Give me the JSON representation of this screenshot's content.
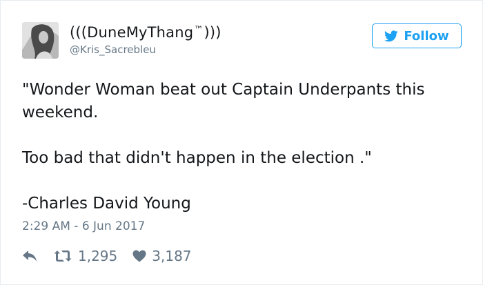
{
  "user": {
    "display_name": "(((DuneMyThang",
    "trademark": "™",
    "name_suffix": ")))",
    "handle": "@Kris_Sacrebleu",
    "avatar_icon": "profile-photo"
  },
  "follow_button": {
    "label": "Follow",
    "icon": "twitter-bird-icon",
    "color": "#1da1f2"
  },
  "tweet": {
    "line1": "\"Wonder Woman beat out Captain Underpants this weekend.",
    "line2": "Too bad that didn't happen in the election .\"",
    "line3": "-Charles David Young"
  },
  "timestamp": "2:29 AM - 6 Jun 2017",
  "actions": {
    "reply_icon": "reply-icon",
    "retweet_icon": "retweet-icon",
    "retweet_count": "1,295",
    "like_icon": "heart-icon",
    "like_count": "3,187"
  }
}
